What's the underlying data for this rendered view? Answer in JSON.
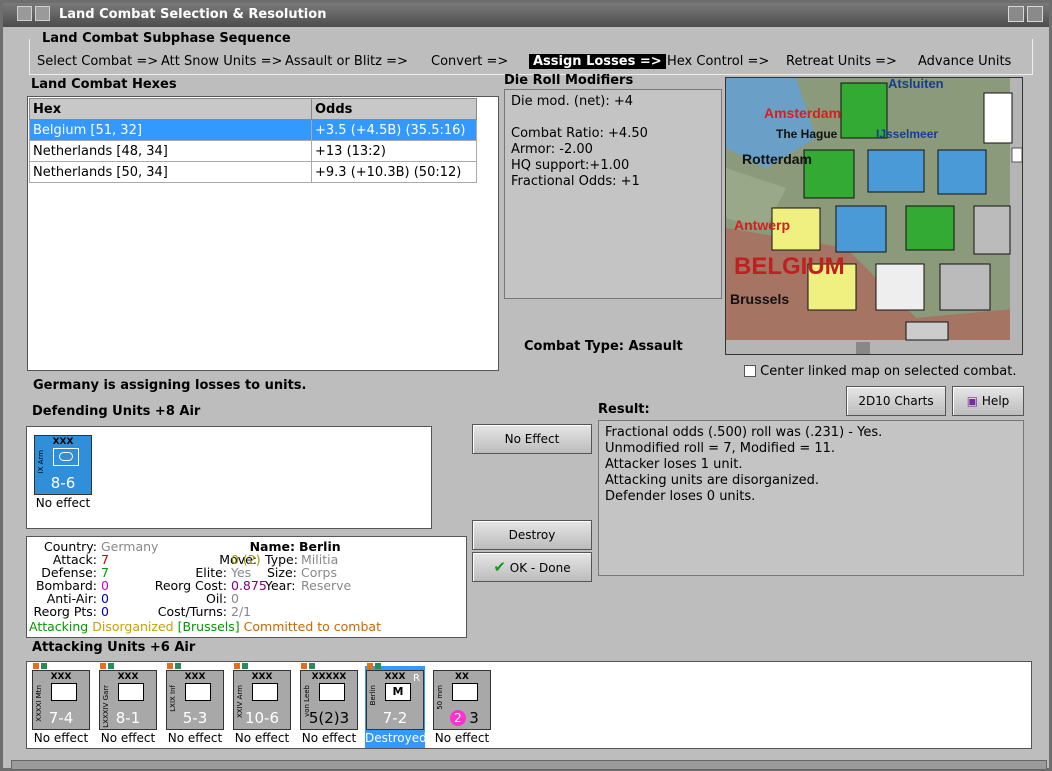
{
  "window": {
    "title": "Land Combat Selection & Resolution"
  },
  "subphase": {
    "title": "Land Combat Subphase Sequence",
    "steps": [
      {
        "label": "Select Combat =>"
      },
      {
        "label": "Att Snow Units =>"
      },
      {
        "label": "Assault or Blitz =>"
      },
      {
        "label": "Convert =>"
      },
      {
        "label": "Assign Losses =>"
      },
      {
        "label": "Hex Control =>"
      },
      {
        "label": "Retreat Units =>"
      },
      {
        "label": "Advance Units"
      }
    ]
  },
  "hexes": {
    "title": "Land Combat Hexes",
    "headers": [
      "Hex",
      "Odds"
    ],
    "rows": [
      {
        "hex": "Belgium [51, 32]",
        "odds": "+3.5 (+4.5B) (35.5:16)"
      },
      {
        "hex": "Netherlands [48, 34]",
        "odds": "+13 (13:2)"
      },
      {
        "hex": "Netherlands [50, 34]",
        "odds": "+9.3 (+10.3B) (50:12)"
      }
    ]
  },
  "die_mods": {
    "title": "Die Roll Modifiers",
    "lines": [
      "Die mod. (net): +4",
      "",
      "Combat Ratio: +4.50",
      "Armor: -2.00",
      "HQ support:+1.00",
      "Fractional Odds: +1"
    ]
  },
  "map": {
    "labels": [
      "Atsluiten",
      "Amsterdam",
      "The Hague",
      "IJsselmeer",
      "Rotterdam",
      "Antwerp",
      "BELGIUM",
      "Brussels"
    ]
  },
  "combat_type": {
    "label": "Combat Type:",
    "value": "Assault"
  },
  "center_map": {
    "label": "Center linked map on selected combat."
  },
  "status": "Germany is assigning losses to units.",
  "buttons": {
    "charts": "2D10 Charts",
    "help": "Help",
    "no_effect": "No Effect",
    "destroy": "Destroy",
    "done": "OK - Done"
  },
  "defending": {
    "title": "Defending Units +8 Air",
    "units": [
      {
        "size": "XXX",
        "side": "IX Arm",
        "strength": "8-6",
        "caption": "No effect"
      }
    ]
  },
  "result": {
    "title": "Result:",
    "lines": [
      "Fractional odds (.500) roll was (.231)  - Yes.",
      "Unmodified roll = 7, Modified = 11.",
      "Attacker loses 1 unit.",
      "Attacking units are disorganized.",
      "Defender loses 0 units."
    ]
  },
  "unit_info": {
    "country_label": "Country:",
    "country": "Germany",
    "attack_label": "Attack:",
    "attack": "7",
    "defense_label": "Defense:",
    "defense": "7",
    "bombard_label": "Bombard:",
    "bombard": "0",
    "antiair_label": "Anti-Air:",
    "antiair": "0",
    "reorg_pts_label": "Reorg Pts:",
    "reorg_pts": "0",
    "name_label": "Name:",
    "name": "Berlin",
    "move_label": "Move:",
    "move": "0 (2)",
    "elite_label": "Elite:",
    "elite": "Yes",
    "reorg_cost_label": "Reorg Cost:",
    "reorg_cost": "0.875",
    "oil_label": "Oil:",
    "oil": "0",
    "cost_turns_label": "Cost/Turns:",
    "cost_turns": "2/1",
    "type_label": "Type:",
    "type": "Militia",
    "size_label": "Size:",
    "size": "Corps",
    "year_label": "Year:",
    "year": "Reserve",
    "status_attacking": "Attacking",
    "status_disorganized": "Disorganized",
    "status_location": "[Brussels]",
    "status_committed": "Committed to combat"
  },
  "attacking": {
    "title": "Attacking Units +6 Air",
    "units": [
      {
        "size": "XXX",
        "side": "XXXXI Mtn",
        "strength": "7-4",
        "caption": "No effect"
      },
      {
        "size": "XXX",
        "side": "LXXXIV Garr",
        "strength": "8-1",
        "caption": "No effect"
      },
      {
        "size": "XXX",
        "side": "LXIX Inf",
        "strength": "5-3",
        "caption": "No effect"
      },
      {
        "size": "XXX",
        "side": "XXIV Arm",
        "strength": "10-6",
        "caption": "No effect"
      },
      {
        "size": "XXXXX",
        "side": "von Leeb",
        "strength": "5(2)3",
        "caption": "No effect"
      },
      {
        "size": "XXX",
        "side": "Berlin",
        "strength": "7-2",
        "caption": "Destroyed",
        "badge": "R"
      },
      {
        "size": "XX",
        "side": "50 mm",
        "strength": "3",
        "caption": "No effect",
        "badge_num": "2"
      }
    ]
  }
}
